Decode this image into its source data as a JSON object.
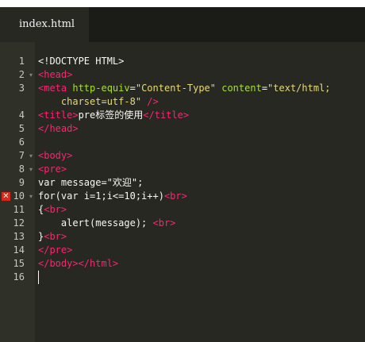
{
  "tab": {
    "label": "index.html"
  },
  "gutter": [
    {
      "number": "1",
      "fold": "",
      "error": ""
    },
    {
      "number": "2",
      "fold": "▾",
      "error": ""
    },
    {
      "number": "3",
      "fold": "",
      "error": ""
    },
    {
      "number": "",
      "fold": "",
      "error": ""
    },
    {
      "number": "4",
      "fold": "",
      "error": ""
    },
    {
      "number": "5",
      "fold": "",
      "error": ""
    },
    {
      "number": "6",
      "fold": "",
      "error": ""
    },
    {
      "number": "7",
      "fold": "▾",
      "error": ""
    },
    {
      "number": "8",
      "fold": "▾",
      "error": ""
    },
    {
      "number": "9",
      "fold": "",
      "error": ""
    },
    {
      "number": "10",
      "fold": "▾",
      "error": "✕"
    },
    {
      "number": "11",
      "fold": "",
      "error": ""
    },
    {
      "number": "12",
      "fold": "",
      "error": ""
    },
    {
      "number": "13",
      "fold": "",
      "error": ""
    },
    {
      "number": "14",
      "fold": "",
      "error": ""
    },
    {
      "number": "15",
      "fold": "",
      "error": ""
    },
    {
      "number": "16",
      "fold": "",
      "error": ""
    }
  ],
  "code": {
    "lines": [
      [
        {
          "text": "<!DOCTYPE HTML>",
          "type": "plain"
        }
      ],
      [
        {
          "text": "<head>",
          "type": "tag"
        }
      ],
      [
        {
          "text": "<meta",
          "type": "tag"
        },
        {
          "text": " ",
          "type": "plain"
        },
        {
          "text": "http-equiv",
          "type": "attr"
        },
        {
          "text": "=",
          "type": "plain"
        },
        {
          "text": "\"Content-Type\"",
          "type": "str"
        },
        {
          "text": " ",
          "type": "plain"
        },
        {
          "text": "content",
          "type": "attr"
        },
        {
          "text": "=",
          "type": "plain"
        },
        {
          "text": "\"text/html;",
          "type": "str"
        }
      ],
      [
        {
          "text": "    ",
          "type": "plain"
        },
        {
          "text": "charset=utf-8\"",
          "type": "str"
        },
        {
          "text": " ",
          "type": "plain"
        },
        {
          "text": "/>",
          "type": "tag"
        }
      ],
      [
        {
          "text": "<title>",
          "type": "tag"
        },
        {
          "text": "pre标签的使用",
          "type": "plain"
        },
        {
          "text": "</title>",
          "type": "tag"
        }
      ],
      [
        {
          "text": "</head>",
          "type": "tag"
        }
      ],
      [
        {
          "text": "",
          "type": "plain"
        }
      ],
      [
        {
          "text": "<body>",
          "type": "tag"
        }
      ],
      [
        {
          "text": "<pre>",
          "type": "tag"
        }
      ],
      [
        {
          "text": "var message=\"欢迎\";",
          "type": "plain"
        }
      ],
      [
        {
          "text": "for(var i=1;i<=10;i++)",
          "type": "plain"
        },
        {
          "text": "<br>",
          "type": "tag"
        }
      ],
      [
        {
          "text": "{",
          "type": "plain"
        },
        {
          "text": "<br>",
          "type": "tag"
        }
      ],
      [
        {
          "text": "    alert(message); ",
          "type": "plain"
        },
        {
          "text": "<br>",
          "type": "tag"
        }
      ],
      [
        {
          "text": "}",
          "type": "plain"
        },
        {
          "text": "<br>",
          "type": "tag"
        }
      ],
      [
        {
          "text": "</pre>",
          "type": "tag"
        }
      ],
      [
        {
          "text": "</body></html>",
          "type": "tag"
        }
      ],
      [
        {
          "text": "",
          "type": "plain"
        }
      ]
    ]
  }
}
